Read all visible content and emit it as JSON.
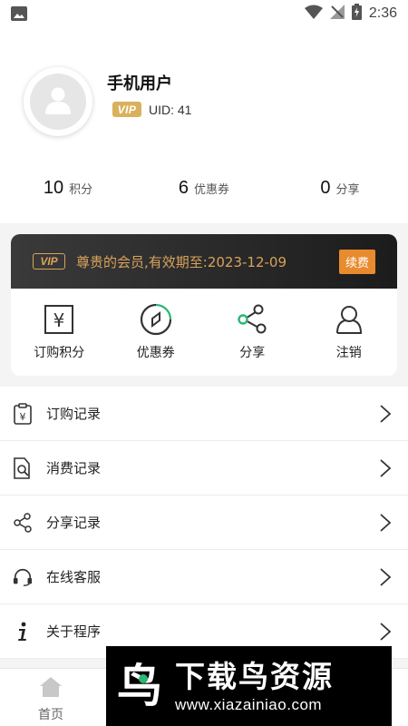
{
  "status_bar": {
    "time": "2:36",
    "icons": [
      "image-icon",
      "wifi-icon",
      "no-signal-icon",
      "battery-charging-icon"
    ]
  },
  "profile": {
    "user_name": "手机用户",
    "vip_badge": "VIP",
    "uid": "UID: 41",
    "avatar_icon": "person-icon"
  },
  "stats": [
    {
      "value": "10",
      "label": "积分"
    },
    {
      "value": "6",
      "label": "优惠券"
    },
    {
      "value": "0",
      "label": "分享"
    }
  ],
  "vip_card": {
    "badge": "VIP",
    "expire_text": "尊贵的会员,有效期至:2023-12-09",
    "renew_label": "续费",
    "accent": "#d9a35a",
    "renew_color": "#e88b2e",
    "actions": [
      {
        "label": "订购积分",
        "icon": "yen-document-icon"
      },
      {
        "label": "优惠券",
        "icon": "coupon-compass-icon"
      },
      {
        "label": "分享",
        "icon": "share-icon"
      },
      {
        "label": "注销",
        "icon": "user-logout-icon"
      }
    ]
  },
  "menu": [
    {
      "label": "订购记录",
      "icon": "yen-clipboard-icon"
    },
    {
      "label": "消费记录",
      "icon": "document-search-icon"
    },
    {
      "label": "分享记录",
      "icon": "share-icon"
    },
    {
      "label": "在线客服",
      "icon": "headset-icon"
    },
    {
      "label": "关于程序",
      "icon": "info-icon"
    }
  ],
  "tabbar": {
    "home_label": "首页",
    "home_icon": "home-icon"
  },
  "watermark": {
    "title": "下载鸟资源",
    "url": "www.xiazainiao.com",
    "logo_letter": "鸟"
  }
}
